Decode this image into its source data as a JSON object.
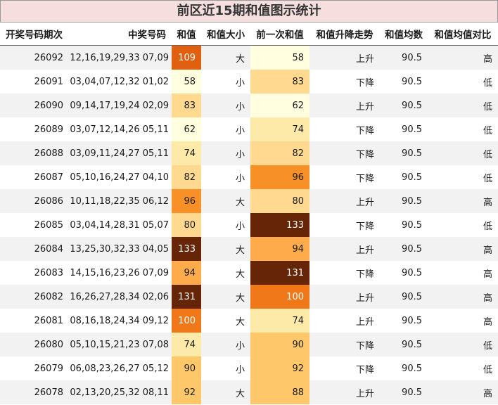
{
  "title": "前区近15期和值图示统计",
  "columns": [
    "开奖号码期次",
    "中奖号码",
    "和值",
    "和值大小",
    "前一次和值",
    "和值升降走势",
    "和值均数",
    "和值均值对比"
  ],
  "heat_colors": {
    "58": "#ffffe0",
    "62": "#ffffe0",
    "74": "#feeaa8",
    "80": "#fed98f",
    "82": "#fed98f",
    "83": "#fed98f",
    "88": "#fec76a",
    "90": "#fec76a",
    "92": "#fec76a",
    "94": "#feab4c",
    "96": "#f89028",
    "100": "#f07818",
    "109": "#e06010",
    "131": "#662506",
    "133": "#662506"
  },
  "rows": [
    {
      "qh": "26092",
      "nums": "12,16,19,29,33 07,09",
      "hz": "109",
      "size": "大",
      "prev": "58",
      "trend": "上升",
      "avg": "90.5",
      "cmp": "高"
    },
    {
      "qh": "26091",
      "nums": "03,04,07,12,32 01,02",
      "hz": "58",
      "size": "小",
      "prev": "83",
      "trend": "下降",
      "avg": "90.5",
      "cmp": "低"
    },
    {
      "qh": "26090",
      "nums": "09,14,17,19,24 02,09",
      "hz": "83",
      "size": "小",
      "prev": "62",
      "trend": "上升",
      "avg": "90.5",
      "cmp": "低"
    },
    {
      "qh": "26089",
      "nums": "03,07,12,14,26 05,11",
      "hz": "62",
      "size": "小",
      "prev": "74",
      "trend": "下降",
      "avg": "90.5",
      "cmp": "低"
    },
    {
      "qh": "26088",
      "nums": "03,09,11,24,27 05,11",
      "hz": "74",
      "size": "小",
      "prev": "82",
      "trend": "下降",
      "avg": "90.5",
      "cmp": "低"
    },
    {
      "qh": "26087",
      "nums": "05,10,16,24,27 04,10",
      "hz": "82",
      "size": "小",
      "prev": "96",
      "trend": "下降",
      "avg": "90.5",
      "cmp": "低"
    },
    {
      "qh": "26086",
      "nums": "10,11,18,22,35 06,12",
      "hz": "96",
      "size": "大",
      "prev": "80",
      "trend": "上升",
      "avg": "90.5",
      "cmp": "高"
    },
    {
      "qh": "26085",
      "nums": "03,04,14,28,31 05,07",
      "hz": "80",
      "size": "小",
      "prev": "133",
      "trend": "下降",
      "avg": "90.5",
      "cmp": "低"
    },
    {
      "qh": "26084",
      "nums": "13,25,30,32,33 04,05",
      "hz": "133",
      "size": "大",
      "prev": "94",
      "trend": "上升",
      "avg": "90.5",
      "cmp": "高"
    },
    {
      "qh": "26083",
      "nums": "14,15,16,23,26 07,09",
      "hz": "94",
      "size": "大",
      "prev": "131",
      "trend": "下降",
      "avg": "90.5",
      "cmp": "高"
    },
    {
      "qh": "26082",
      "nums": "16,26,27,28,34 02,06",
      "hz": "131",
      "size": "大",
      "prev": "100",
      "trend": "上升",
      "avg": "90.5",
      "cmp": "高"
    },
    {
      "qh": "26081",
      "nums": "08,16,18,24,34 09,12",
      "hz": "100",
      "size": "大",
      "prev": "74",
      "trend": "上升",
      "avg": "90.5",
      "cmp": "高"
    },
    {
      "qh": "26080",
      "nums": "05,10,15,21,23 07,08",
      "hz": "74",
      "size": "小",
      "prev": "90",
      "trend": "下降",
      "avg": "90.5",
      "cmp": "低"
    },
    {
      "qh": "26079",
      "nums": "06,08,23,26,27 05,12",
      "hz": "90",
      "size": "小",
      "prev": "92",
      "trend": "下降",
      "avg": "90.5",
      "cmp": "低"
    },
    {
      "qh": "26078",
      "nums": "02,13,20,25,32 08,11",
      "hz": "92",
      "size": "大",
      "prev": "88",
      "trend": "上升",
      "avg": "90.5",
      "cmp": "高"
    }
  ]
}
